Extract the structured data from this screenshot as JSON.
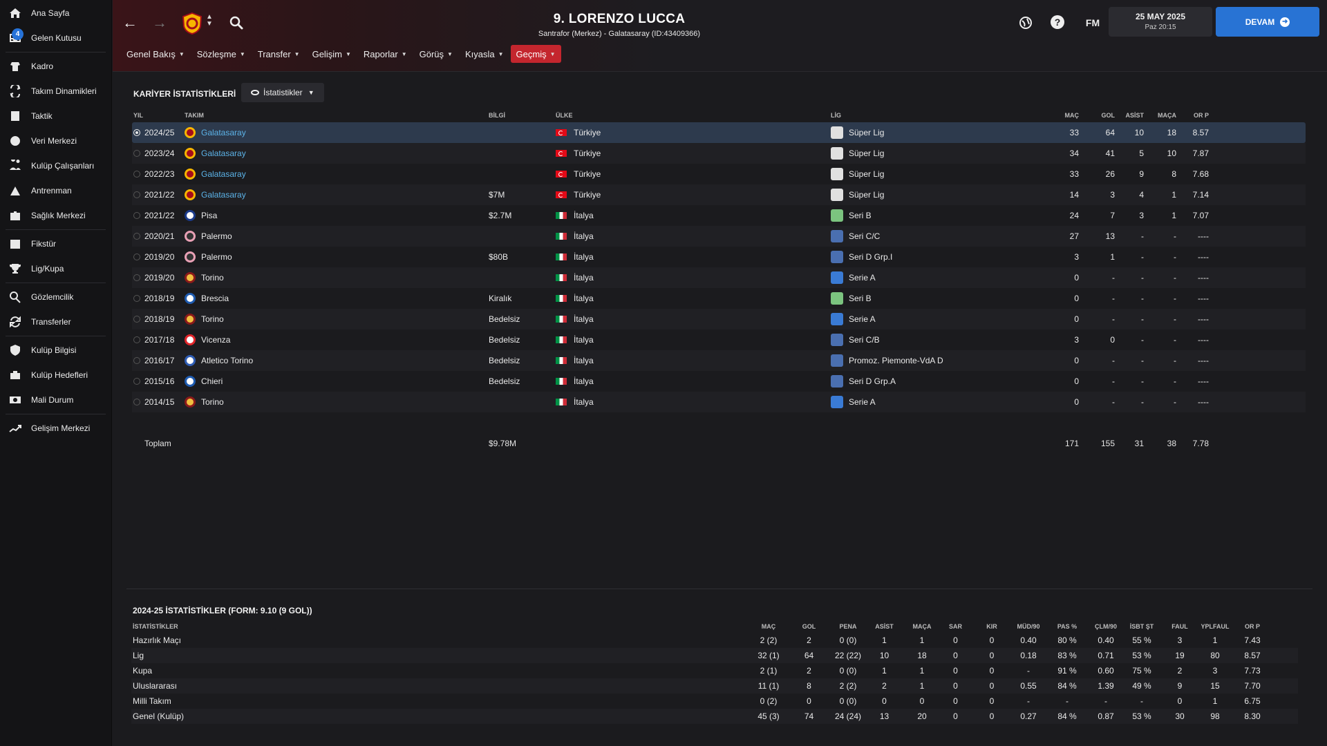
{
  "sidebar": {
    "items": [
      {
        "label": "Ana Sayfa",
        "icon": "home-icon"
      },
      {
        "label": "Gelen Kutusu",
        "icon": "inbox-icon",
        "badge": "4"
      },
      {
        "label": "Kadro",
        "icon": "squad-icon"
      },
      {
        "label": "Takım Dinamikleri",
        "icon": "dynamics-icon"
      },
      {
        "label": "Taktik",
        "icon": "tactics-icon"
      },
      {
        "label": "Veri Merkezi",
        "icon": "data-icon"
      },
      {
        "label": "Kulüp Çalışanları",
        "icon": "staff-icon"
      },
      {
        "label": "Antrenman",
        "icon": "training-icon"
      },
      {
        "label": "Sağlık Merkezi",
        "icon": "medical-icon"
      },
      {
        "label": "Fikstür",
        "icon": "calendar-icon"
      },
      {
        "label": "Lig/Kupa",
        "icon": "trophy-icon"
      },
      {
        "label": "Gözlemcilik",
        "icon": "scouting-icon"
      },
      {
        "label": "Transferler",
        "icon": "transfers-icon"
      },
      {
        "label": "Kulüp Bilgisi",
        "icon": "shield-icon"
      },
      {
        "label": "Kulüp Hedefleri",
        "icon": "goals-icon"
      },
      {
        "label": "Mali Durum",
        "icon": "finance-icon"
      },
      {
        "label": "Gelişim Merkezi",
        "icon": "development-icon"
      }
    ]
  },
  "header": {
    "title": "9. LORENZO LUCCA",
    "subtitle": "Santrafor (Merkez) - Galatasaray (ID:43409366)",
    "date": "25 MAY 2025",
    "time": "Paz 20:15",
    "continue_label": "DEVAM",
    "fm_label": "FM"
  },
  "tabs": [
    {
      "label": "Genel Bakış",
      "active": false
    },
    {
      "label": "Sözleşme",
      "active": false
    },
    {
      "label": "Transfer",
      "active": false
    },
    {
      "label": "Gelişim",
      "active": false
    },
    {
      "label": "Raporlar",
      "active": false
    },
    {
      "label": "Görüş",
      "active": false
    },
    {
      "label": "Kıyasla",
      "active": false
    },
    {
      "label": "Geçmiş",
      "active": true
    }
  ],
  "career": {
    "title": "KARİYER İSTATİSTİKLERİ",
    "toggle_label": "İstatistikler",
    "columns": [
      "YIL",
      "TAKIM",
      "BİLGİ",
      "ÜLKE",
      "LİG",
      "MAÇ",
      "GOL",
      "ASİST",
      "MAÇA",
      "OR P"
    ],
    "rows": [
      {
        "year": "2024/25",
        "team": "Galatasaray",
        "info": "",
        "country": "Türkiye",
        "flag": "tr",
        "league": "Süper Lig",
        "mac": "33",
        "gol": "64",
        "asist": "10",
        "maca": "18",
        "orp": "8.57",
        "selected": true,
        "link": true
      },
      {
        "year": "2023/24",
        "team": "Galatasaray",
        "info": "",
        "country": "Türkiye",
        "flag": "tr",
        "league": "Süper Lig",
        "mac": "34",
        "gol": "41",
        "asist": "5",
        "maca": "10",
        "orp": "7.87",
        "link": true
      },
      {
        "year": "2022/23",
        "team": "Galatasaray",
        "info": "",
        "country": "Türkiye",
        "flag": "tr",
        "league": "Süper Lig",
        "mac": "33",
        "gol": "26",
        "asist": "9",
        "maca": "8",
        "orp": "7.68",
        "link": true
      },
      {
        "year": "2021/22",
        "team": "Galatasaray",
        "info": "$7M",
        "country": "Türkiye",
        "flag": "tr",
        "league": "Süper Lig",
        "mac": "14",
        "gol": "3",
        "asist": "4",
        "maca": "1",
        "orp": "7.14",
        "link": true
      },
      {
        "year": "2021/22",
        "team": "Pisa",
        "info": "$2.7M",
        "country": "İtalya",
        "flag": "it",
        "league": "Seri B",
        "mac": "24",
        "gol": "7",
        "asist": "3",
        "maca": "1",
        "orp": "7.07"
      },
      {
        "year": "2020/21",
        "team": "Palermo",
        "info": "",
        "country": "İtalya",
        "flag": "it",
        "league": "Seri C/C",
        "mac": "27",
        "gol": "13",
        "asist": "-",
        "maca": "-",
        "orp": "----"
      },
      {
        "year": "2019/20",
        "team": "Palermo",
        "info": "$80B",
        "country": "İtalya",
        "flag": "it",
        "league": "Seri D Grp.I",
        "mac": "3",
        "gol": "1",
        "asist": "-",
        "maca": "-",
        "orp": "----"
      },
      {
        "year": "2019/20",
        "team": "Torino",
        "info": "",
        "country": "İtalya",
        "flag": "it",
        "league": "Serie A",
        "mac": "0",
        "gol": "-",
        "asist": "-",
        "maca": "-",
        "orp": "----"
      },
      {
        "year": "2018/19",
        "team": "Brescia",
        "info": "Kiralık",
        "country": "İtalya",
        "flag": "it",
        "league": "Seri B",
        "mac": "0",
        "gol": "-",
        "asist": "-",
        "maca": "-",
        "orp": "----"
      },
      {
        "year": "2018/19",
        "team": "Torino",
        "info": "Bedelsiz",
        "country": "İtalya",
        "flag": "it",
        "league": "Serie A",
        "mac": "0",
        "gol": "-",
        "asist": "-",
        "maca": "-",
        "orp": "----"
      },
      {
        "year": "2017/18",
        "team": "Vicenza",
        "info": "Bedelsiz",
        "country": "İtalya",
        "flag": "it",
        "league": "Seri C/B",
        "mac": "3",
        "gol": "0",
        "asist": "-",
        "maca": "-",
        "orp": "----"
      },
      {
        "year": "2016/17",
        "team": "Atletico Torino",
        "info": "Bedelsiz",
        "country": "İtalya",
        "flag": "it",
        "league": "Promoz. Piemonte-VdA D",
        "mac": "0",
        "gol": "-",
        "asist": "-",
        "maca": "-",
        "orp": "----"
      },
      {
        "year": "2015/16",
        "team": "Chieri",
        "info": "Bedelsiz",
        "country": "İtalya",
        "flag": "it",
        "league": "Seri D Grp.A",
        "mac": "0",
        "gol": "-",
        "asist": "-",
        "maca": "-",
        "orp": "----"
      },
      {
        "year": "2014/15",
        "team": "Torino",
        "info": "",
        "country": "İtalya",
        "flag": "it",
        "league": "Serie A",
        "mac": "0",
        "gol": "-",
        "asist": "-",
        "maca": "-",
        "orp": "----"
      }
    ],
    "total": {
      "label": "Toplam",
      "info": "$9.78M",
      "mac": "171",
      "gol": "155",
      "asist": "31",
      "maca": "38",
      "orp": "7.78"
    }
  },
  "season": {
    "title": "2024-25 İSTATİSTİKLER (FORM: 9.10 (9 GOL))",
    "columns": [
      "İSTATİSTİKLER",
      "MAÇ",
      "GOL",
      "PENA",
      "ASİST",
      "MAÇA",
      "SAR",
      "KIR",
      "MÜD/90",
      "PAS %",
      "ÇLM/90",
      "İSBT ŞT",
      "FAUL",
      "YPLFAUL",
      "OR P"
    ],
    "rows": [
      [
        "Hazırlık Maçı",
        "2 (2)",
        "2",
        "0 (0)",
        "1",
        "1",
        "0",
        "0",
        "0.40",
        "80 %",
        "0.40",
        "55 %",
        "3",
        "1",
        "7.43"
      ],
      [
        "Lig",
        "32 (1)",
        "64",
        "22 (22)",
        "10",
        "18",
        "0",
        "0",
        "0.18",
        "83 %",
        "0.71",
        "53 %",
        "19",
        "80",
        "8.57"
      ],
      [
        "Kupa",
        "2 (1)",
        "2",
        "0 (0)",
        "1",
        "1",
        "0",
        "0",
        "-",
        "91 %",
        "0.60",
        "75 %",
        "2",
        "3",
        "7.73"
      ],
      [
        "Uluslararası",
        "11 (1)",
        "8",
        "2 (2)",
        "2",
        "1",
        "0",
        "0",
        "0.55",
        "84 %",
        "1.39",
        "49 %",
        "9",
        "15",
        "7.70"
      ],
      [
        "Milli Takım",
        "0 (2)",
        "0",
        "0 (0)",
        "0",
        "0",
        "0",
        "0",
        "-",
        "-",
        "-",
        "-",
        "0",
        "1",
        "6.75"
      ],
      [
        "Genel (Kulüp)",
        "45 (3)",
        "74",
        "24 (24)",
        "13",
        "20",
        "0",
        "0",
        "0.27",
        "84 %",
        "0.87",
        "53 %",
        "30",
        "98",
        "8.30"
      ]
    ]
  },
  "colors": {
    "accent": "#c4262e",
    "continue": "#2873d4",
    "link": "#5cb3e8"
  }
}
